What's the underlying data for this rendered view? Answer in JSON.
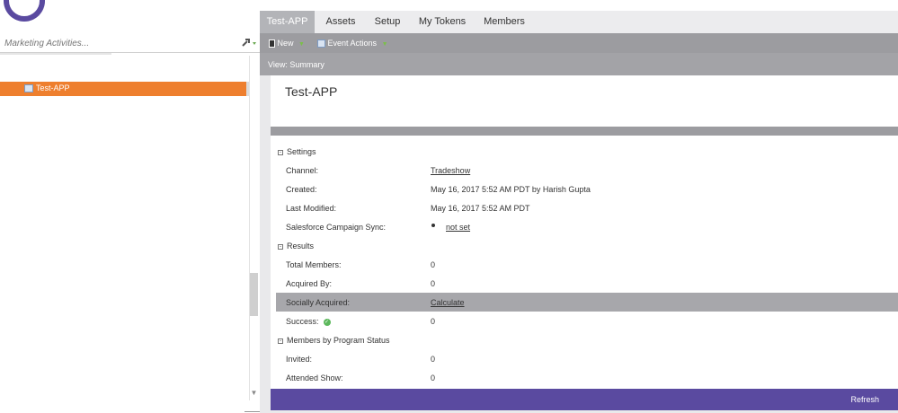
{
  "left": {
    "search_placeholder": "Marketing Activities...",
    "tree_item": "Test-APP"
  },
  "tabs": [
    "Test-APP",
    "Assets",
    "Setup",
    "My Tokens",
    "Members"
  ],
  "toolbar": {
    "new_label": "New",
    "event_actions_label": "Event Actions"
  },
  "view_label": "View: Summary",
  "title": "Test-APP",
  "settings": {
    "header": "Settings",
    "channel_label": "Channel:",
    "channel_value": "Tradeshow",
    "created_label": "Created:",
    "created_value": "May 16, 2017 5:52 AM PDT by Harish Gupta",
    "modified_label": "Last Modified:",
    "modified_value": "May 16, 2017 5:52 AM PDT",
    "sync_label": "Salesforce Campaign Sync:",
    "sync_value": "not set"
  },
  "results": {
    "header": "Results",
    "total_label": "Total Members:",
    "total_value": "0",
    "acquired_label": "Acquired By:",
    "acquired_value": "0",
    "social_label": "Socially Acquired:",
    "social_value": "Calculate",
    "success_label": "Success:",
    "success_value": "0"
  },
  "status": {
    "header": "Members by Program Status",
    "invited_label": "Invited:",
    "invited_value": "0",
    "attended_label": "Attended Show:",
    "attended_value": "0"
  },
  "footer": {
    "refresh_label": "Refresh"
  },
  "colors": {
    "accent": "#ee7f2e",
    "brand": "#5a4aa0",
    "success": "#5cb85c"
  }
}
